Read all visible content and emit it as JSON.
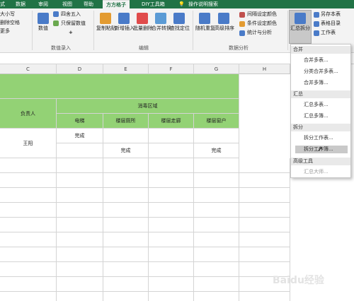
{
  "tabs": [
    "式",
    "数据",
    "审阅",
    "视图",
    "帮助",
    "方方格子",
    "DIY工具箱",
    "操作说明搜索"
  ],
  "ribbon": {
    "left_items": [
      "大小写",
      "删除空格",
      "更多"
    ],
    "numeric": {
      "items": [
        "四舍五入",
        "只保留数值"
      ],
      "big": "数值",
      "plus": "+"
    },
    "groups": [
      "数值录入",
      "编辑",
      "数据分析"
    ],
    "edit_buttons": [
      "复制粘贴",
      "新增插入",
      "批量删除",
      "合并转换",
      "查找定位"
    ],
    "analysis_buttons": [
      "随机重复",
      "高级排序"
    ],
    "analysis_items": [
      "间隔设定颜色",
      "条件设定颜色",
      "统计与分析"
    ],
    "summary": {
      "big": "汇总拆分",
      "items": [
        "另存本表",
        "表格目录",
        "工作表"
      ]
    }
  },
  "columns": [
    "C",
    "D",
    "E",
    "F",
    "G",
    "H"
  ],
  "sheet": {
    "header_merged": "消毒区域",
    "owner_label": "负责人",
    "sub_headers": [
      "电梯",
      "楼层厕所",
      "楼层走廊",
      "楼层窗户"
    ],
    "owner": "王阳",
    "status": "完成"
  },
  "menu": {
    "sections": [
      {
        "title": "合并",
        "items": [
          "合并多表...",
          "分类合并多表...",
          "合并多簿..."
        ]
      },
      {
        "title": "汇总",
        "items": [
          "汇总多表...",
          "汇总多簿..."
        ]
      },
      {
        "title": "拆分",
        "items": [
          "拆分工作表...",
          "拆分工作簿..."
        ]
      },
      {
        "title": "高级工具",
        "items": [
          "汇总大师..."
        ]
      }
    ]
  },
  "watermark": "Baidu经验"
}
